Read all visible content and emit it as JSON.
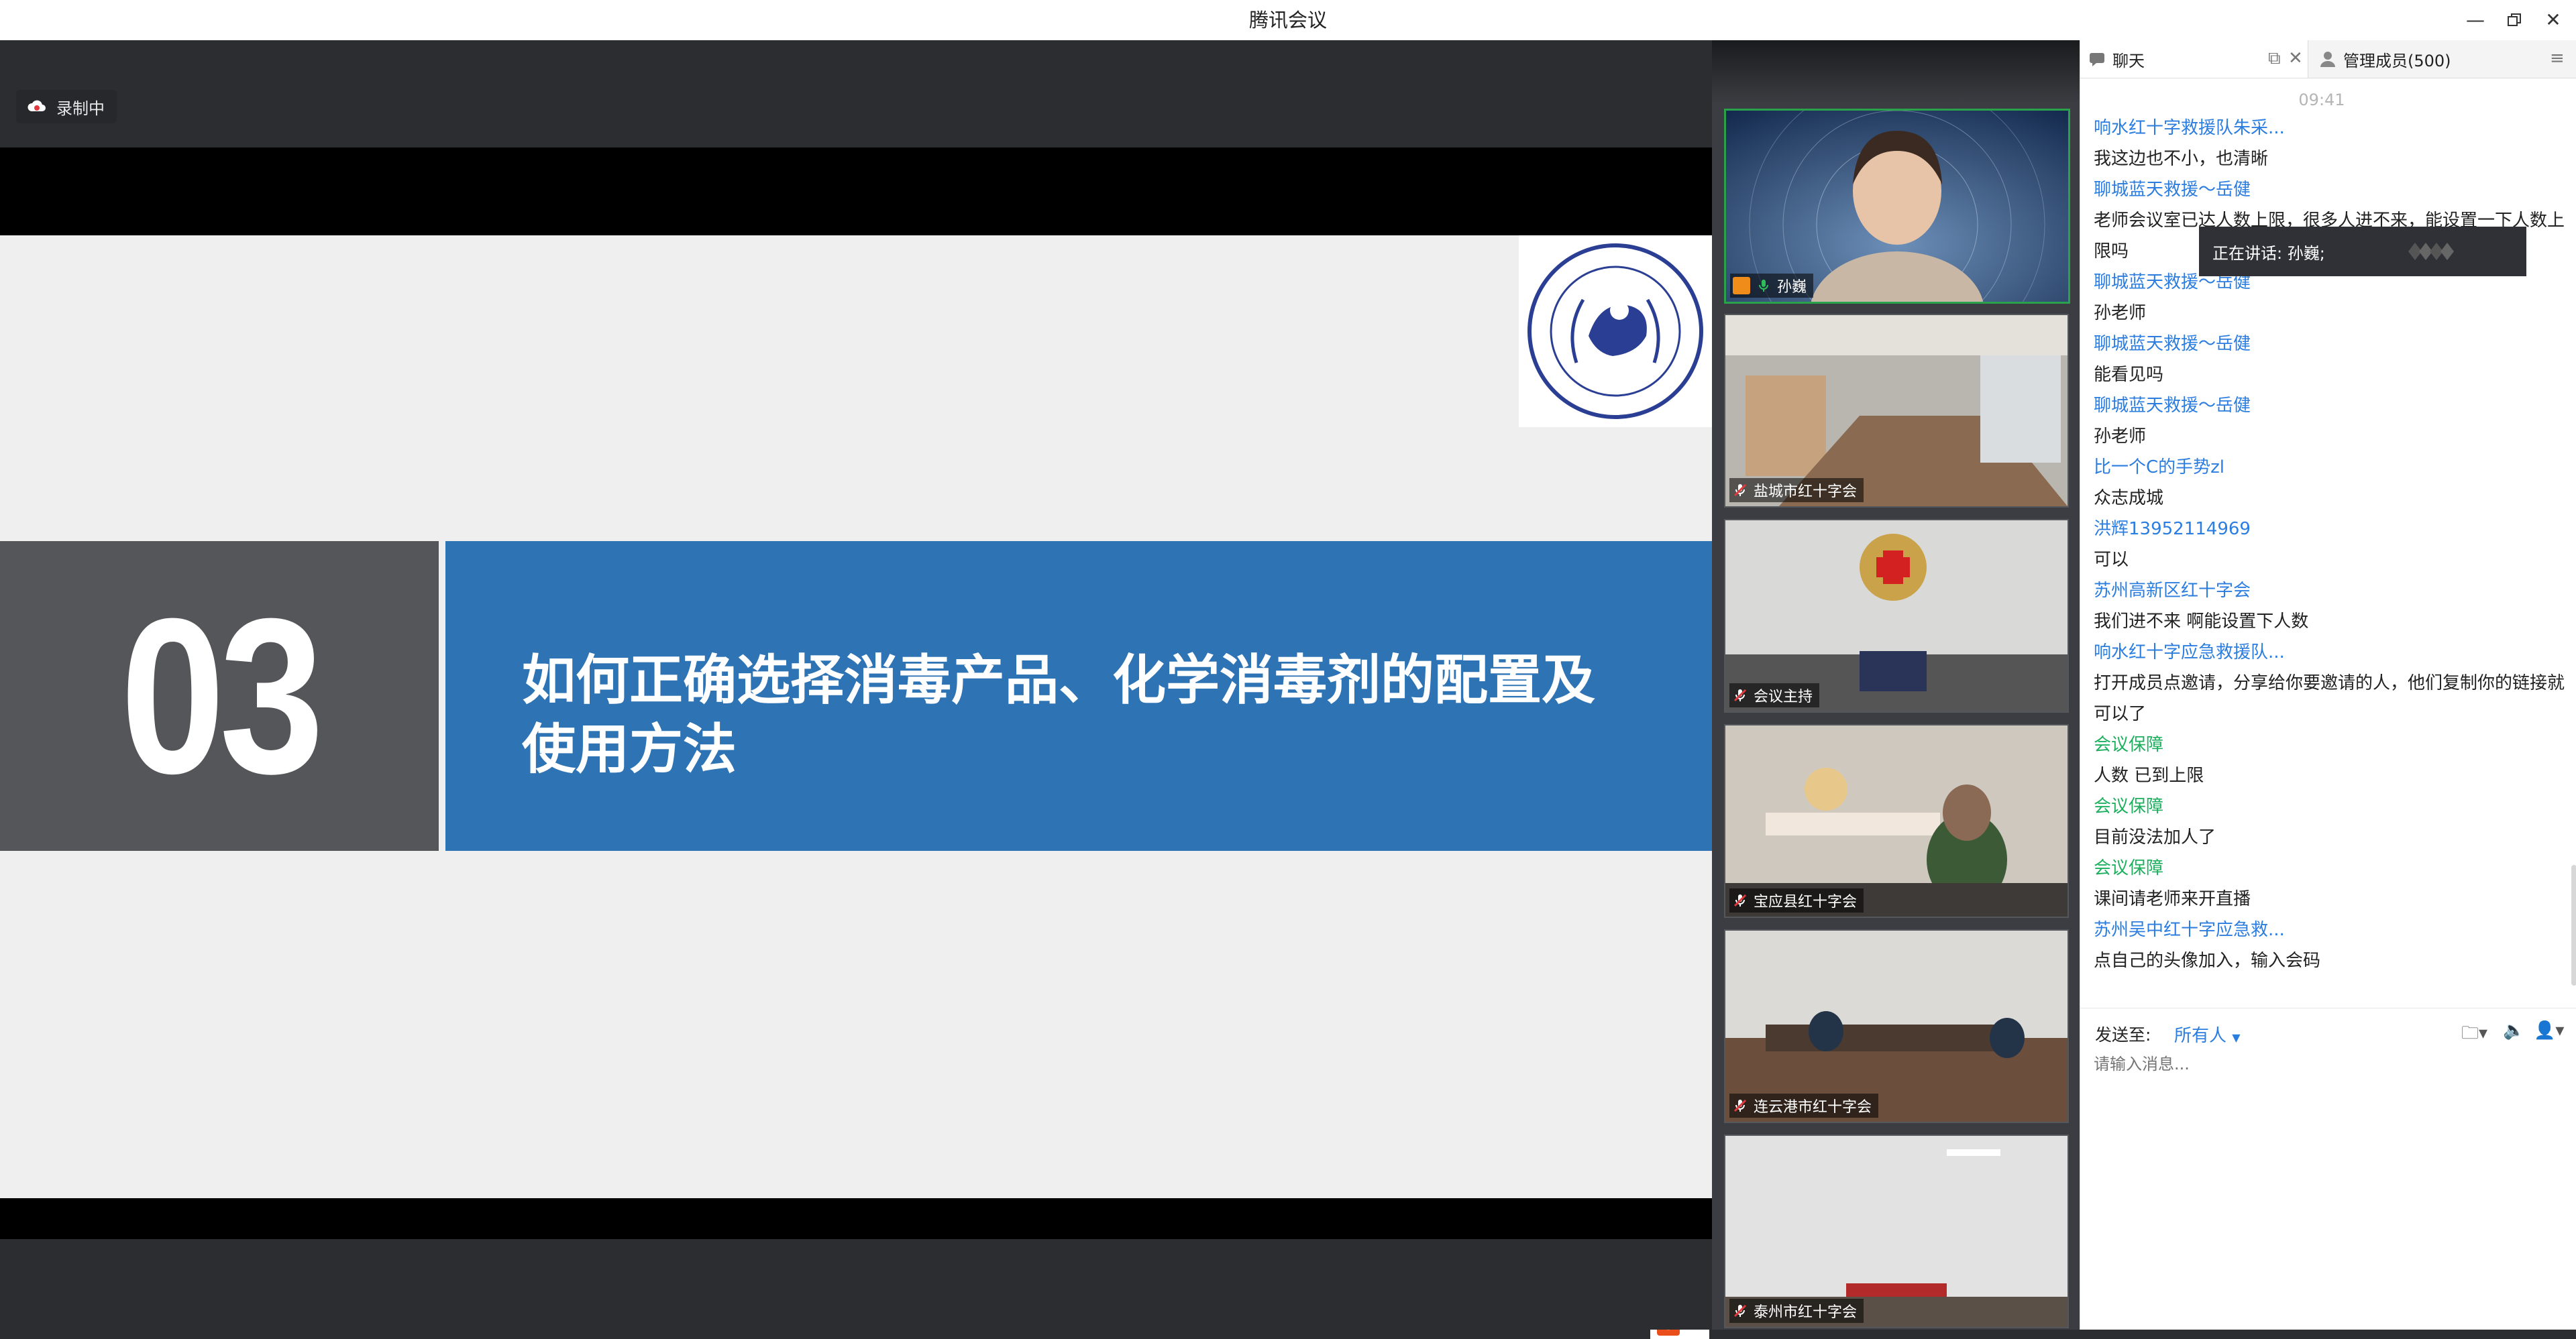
{
  "window": {
    "title": "腾讯会议"
  },
  "recording": {
    "label": "录制中"
  },
  "slide": {
    "number": "03",
    "title_line1": "如何正确选择消毒产品、化学消毒剂的配置及",
    "title_line2": "使用方法"
  },
  "participants": [
    {
      "name": "孙巍",
      "active": true
    },
    {
      "name": "盐城市红十字会",
      "active": false
    },
    {
      "name": "会议主持",
      "active": false
    },
    {
      "name": "宝应县红十字会",
      "active": false
    },
    {
      "name": "连云港市红十字会",
      "active": false
    },
    {
      "name": "泰州市红十字会",
      "active": false
    }
  ],
  "chat_panel": {
    "tab_chat": "聊天",
    "tab_members": "管理成员(500)",
    "time": "09:41",
    "messages": [
      {
        "sender": "响水红十字救援队朱采...",
        "text": "我这边也不小，也清晰",
        "sender_color": "blue"
      },
      {
        "sender": "聊城蓝天救援～岳健",
        "text": "老师会议室已达人数上限，很多人进不来，能设置一下人数上限吗",
        "sender_color": "blue"
      },
      {
        "sender": "聊城蓝天救援～岳健",
        "text": "孙老师",
        "sender_color": "blue"
      },
      {
        "sender": "聊城蓝天救援～岳健",
        "text": "能看见吗",
        "sender_color": "blue"
      },
      {
        "sender": "聊城蓝天救援～岳健",
        "text": "孙老师",
        "sender_color": "blue"
      },
      {
        "sender": "比一个C的手势zl",
        "text": "众志成城",
        "sender_color": "blue"
      },
      {
        "sender": "洪辉13952114969",
        "text": "可以",
        "sender_color": "blue"
      },
      {
        "sender": "苏州高新区红十字会",
        "text": "我们进不来 啊能设置下人数",
        "sender_color": "blue"
      },
      {
        "sender": "响水红十字应急救援队...",
        "text": "打开成员点邀请，分享给你要邀请的人，他们复制你的链接就可以了",
        "sender_color": "blue"
      },
      {
        "sender": "会议保障",
        "text": "人数 已到上限",
        "sender_color": "green"
      },
      {
        "sender": "会议保障",
        "text": "目前没法加人了",
        "sender_color": "green"
      },
      {
        "sender": "会议保障",
        "text": "课间请老师来开直播",
        "sender_color": "green"
      },
      {
        "sender": "苏州吴中红十字应急救...",
        "text": "点自己的头像加入，输入会码",
        "sender_color": "blue"
      }
    ],
    "speaking_toast": "正在讲话: 孙巍;",
    "send_to_label": "发送至:",
    "send_to_value": "所有人",
    "input_placeholder": "请输入消息..."
  },
  "colors": {
    "slide_blue": "#2e74b5",
    "slide_gray": "#555659",
    "sender_blue": "#2b7de0",
    "sender_green": "#1eaf5f",
    "active_border": "#2aa14b"
  }
}
